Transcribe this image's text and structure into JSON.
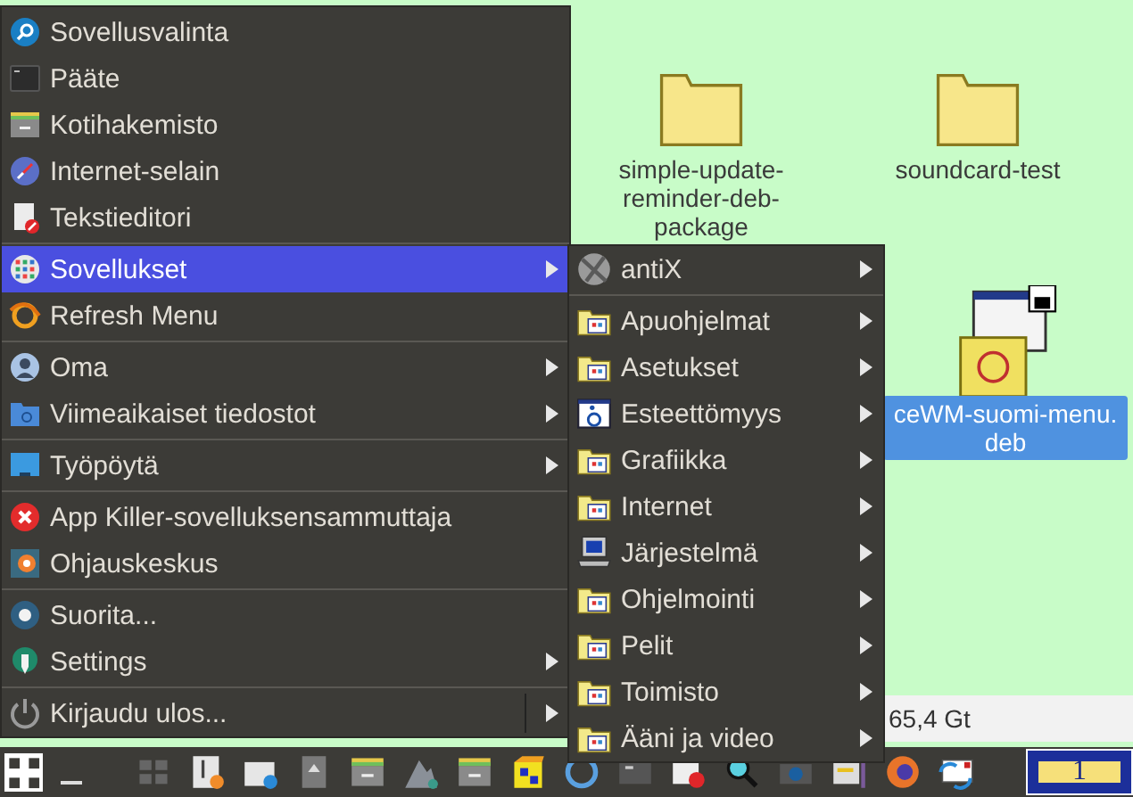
{
  "desktop": {
    "icons": [
      {
        "kind": "folder",
        "label": "simple-update-reminder-deb-package",
        "selected": false
      },
      {
        "kind": "folder",
        "label": "soundcard-test",
        "selected": false
      },
      {
        "kind": "package",
        "label": "ceWM-suomi-menu. deb",
        "selected": true
      }
    ],
    "status_text": "65,4 Gt"
  },
  "menu": {
    "groups": [
      [
        {
          "label": "Sovellusvalinta",
          "submenu": false,
          "selected": false
        },
        {
          "label": "Pääte",
          "submenu": false,
          "selected": false
        },
        {
          "label": "Kotihakemisto",
          "submenu": false,
          "selected": false
        },
        {
          "label": "Internet-selain",
          "submenu": false,
          "selected": false
        },
        {
          "label": "Tekstieditori",
          "submenu": false,
          "selected": false
        }
      ],
      [
        {
          "label": "Sovellukset",
          "submenu": true,
          "selected": true
        },
        {
          "label": "Refresh Menu",
          "submenu": false,
          "selected": false
        }
      ],
      [
        {
          "label": "Oma",
          "submenu": true,
          "selected": false
        },
        {
          "label": "Viimeaikaiset tiedostot",
          "submenu": true,
          "selected": false
        }
      ],
      [
        {
          "label": "Työpöytä",
          "submenu": true,
          "selected": false
        }
      ],
      [
        {
          "label": "App Killer-sovelluksensammuttaja",
          "submenu": false,
          "selected": false
        },
        {
          "label": "Ohjauskeskus",
          "submenu": false,
          "selected": false
        }
      ],
      [
        {
          "label": "Suorita...",
          "submenu": false,
          "selected": false
        },
        {
          "label": "Settings",
          "submenu": true,
          "selected": false
        }
      ],
      [
        {
          "label": "Kirjaudu ulos...",
          "submenu": true,
          "selected": false
        }
      ]
    ]
  },
  "submenu": {
    "groups": [
      [
        {
          "label": "antiX",
          "submenu": true,
          "selected": false
        }
      ],
      [
        {
          "label": "Apuohjelmat",
          "submenu": true,
          "selected": false
        },
        {
          "label": "Asetukset",
          "submenu": true,
          "selected": false
        },
        {
          "label": "Esteettömyys",
          "submenu": true,
          "selected": false
        },
        {
          "label": "Grafiikka",
          "submenu": true,
          "selected": false
        },
        {
          "label": "Internet",
          "submenu": true,
          "selected": false
        },
        {
          "label": "Järjestelmä",
          "submenu": true,
          "selected": false
        },
        {
          "label": "Ohjelmointi",
          "submenu": true,
          "selected": false
        },
        {
          "label": "Pelit",
          "submenu": true,
          "selected": false
        },
        {
          "label": "Toimisto",
          "submenu": true,
          "selected": false
        },
        {
          "label": "Ääni ja video",
          "submenu": true,
          "selected": false
        }
      ]
    ]
  },
  "taskbar": {
    "workspace": {
      "label": "1",
      "selected": true
    }
  }
}
